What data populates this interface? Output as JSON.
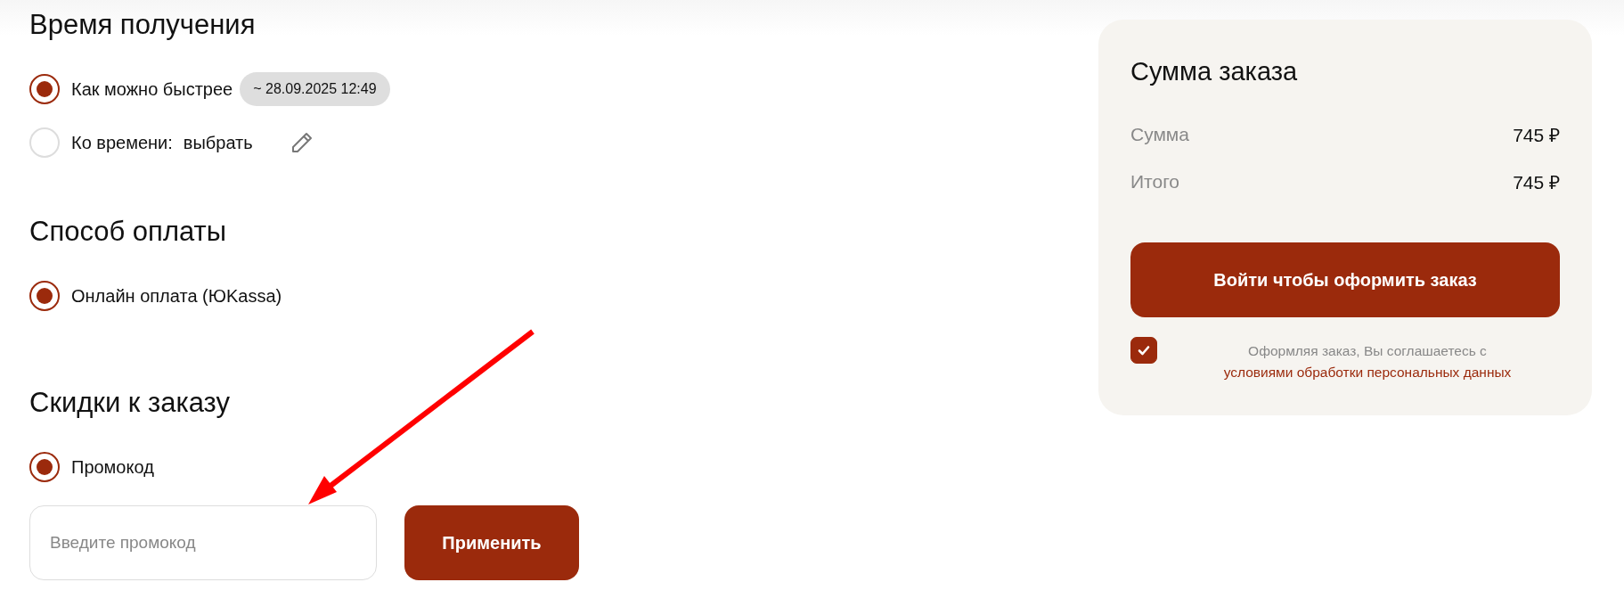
{
  "sections": [
    {
      "kind": "time",
      "title": "Время получения",
      "options": [
        {
          "label": "Как можно быстрее",
          "selected": true,
          "badge": "~ 28.09.2025 12:49"
        },
        {
          "label": "Ко времени:",
          "value": "выбрать",
          "selected": false,
          "editable": true
        }
      ]
    },
    {
      "kind": "payment",
      "title": "Способ оплаты",
      "options": [
        {
          "label": "Онлайн оплата (ЮKassa)",
          "selected": true
        }
      ]
    },
    {
      "kind": "discounts",
      "title": "Скидки к заказу",
      "options": [
        {
          "label": "Промокод",
          "selected": true
        }
      ],
      "promo": {
        "placeholder": "Введите промокод",
        "button": "Применить"
      }
    }
  ],
  "summary": {
    "title": "Сумма заказа",
    "rows": [
      {
        "label": "Сумма",
        "value": "745 ₽"
      },
      {
        "label": "Итого",
        "value": "745 ₽"
      }
    ],
    "submit": "Войти чтобы оформить заказ",
    "consent": {
      "checked": true,
      "text": "Оформляя заказ, Вы соглашаетесь с",
      "link": "условиями обработки персональных данных"
    }
  }
}
